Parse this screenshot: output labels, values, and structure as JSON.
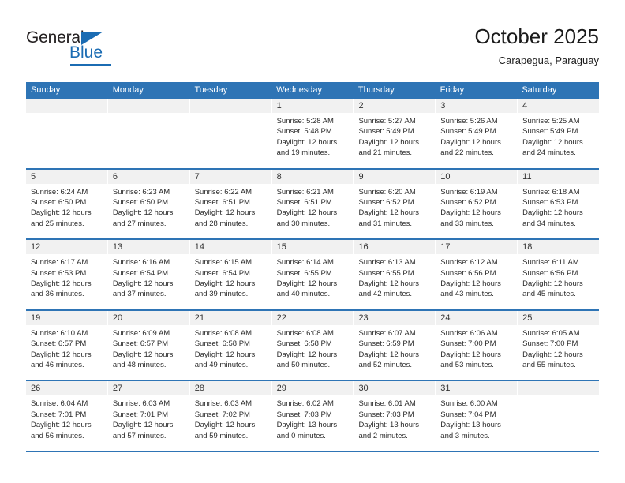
{
  "brand": {
    "name_part1": "General",
    "name_part2": "Blue",
    "accent_color": "#1b6cb3"
  },
  "header": {
    "title": "October 2025",
    "subtitle": "Carapegua, Paraguay"
  },
  "calendar": {
    "header_bg": "#2e74b5",
    "daynum_bg": "#f1f1f1",
    "weekdays": [
      "Sunday",
      "Monday",
      "Tuesday",
      "Wednesday",
      "Thursday",
      "Friday",
      "Saturday"
    ],
    "weeks": [
      [
        {
          "day": "",
          "lines": []
        },
        {
          "day": "",
          "lines": []
        },
        {
          "day": "",
          "lines": []
        },
        {
          "day": "1",
          "lines": [
            "Sunrise: 5:28 AM",
            "Sunset: 5:48 PM",
            "Daylight: 12 hours",
            "and 19 minutes."
          ]
        },
        {
          "day": "2",
          "lines": [
            "Sunrise: 5:27 AM",
            "Sunset: 5:49 PM",
            "Daylight: 12 hours",
            "and 21 minutes."
          ]
        },
        {
          "day": "3",
          "lines": [
            "Sunrise: 5:26 AM",
            "Sunset: 5:49 PM",
            "Daylight: 12 hours",
            "and 22 minutes."
          ]
        },
        {
          "day": "4",
          "lines": [
            "Sunrise: 5:25 AM",
            "Sunset: 5:49 PM",
            "Daylight: 12 hours",
            "and 24 minutes."
          ]
        }
      ],
      [
        {
          "day": "5",
          "lines": [
            "Sunrise: 6:24 AM",
            "Sunset: 6:50 PM",
            "Daylight: 12 hours",
            "and 25 minutes."
          ]
        },
        {
          "day": "6",
          "lines": [
            "Sunrise: 6:23 AM",
            "Sunset: 6:50 PM",
            "Daylight: 12 hours",
            "and 27 minutes."
          ]
        },
        {
          "day": "7",
          "lines": [
            "Sunrise: 6:22 AM",
            "Sunset: 6:51 PM",
            "Daylight: 12 hours",
            "and 28 minutes."
          ]
        },
        {
          "day": "8",
          "lines": [
            "Sunrise: 6:21 AM",
            "Sunset: 6:51 PM",
            "Daylight: 12 hours",
            "and 30 minutes."
          ]
        },
        {
          "day": "9",
          "lines": [
            "Sunrise: 6:20 AM",
            "Sunset: 6:52 PM",
            "Daylight: 12 hours",
            "and 31 minutes."
          ]
        },
        {
          "day": "10",
          "lines": [
            "Sunrise: 6:19 AM",
            "Sunset: 6:52 PM",
            "Daylight: 12 hours",
            "and 33 minutes."
          ]
        },
        {
          "day": "11",
          "lines": [
            "Sunrise: 6:18 AM",
            "Sunset: 6:53 PM",
            "Daylight: 12 hours",
            "and 34 minutes."
          ]
        }
      ],
      [
        {
          "day": "12",
          "lines": [
            "Sunrise: 6:17 AM",
            "Sunset: 6:53 PM",
            "Daylight: 12 hours",
            "and 36 minutes."
          ]
        },
        {
          "day": "13",
          "lines": [
            "Sunrise: 6:16 AM",
            "Sunset: 6:54 PM",
            "Daylight: 12 hours",
            "and 37 minutes."
          ]
        },
        {
          "day": "14",
          "lines": [
            "Sunrise: 6:15 AM",
            "Sunset: 6:54 PM",
            "Daylight: 12 hours",
            "and 39 minutes."
          ]
        },
        {
          "day": "15",
          "lines": [
            "Sunrise: 6:14 AM",
            "Sunset: 6:55 PM",
            "Daylight: 12 hours",
            "and 40 minutes."
          ]
        },
        {
          "day": "16",
          "lines": [
            "Sunrise: 6:13 AM",
            "Sunset: 6:55 PM",
            "Daylight: 12 hours",
            "and 42 minutes."
          ]
        },
        {
          "day": "17",
          "lines": [
            "Sunrise: 6:12 AM",
            "Sunset: 6:56 PM",
            "Daylight: 12 hours",
            "and 43 minutes."
          ]
        },
        {
          "day": "18",
          "lines": [
            "Sunrise: 6:11 AM",
            "Sunset: 6:56 PM",
            "Daylight: 12 hours",
            "and 45 minutes."
          ]
        }
      ],
      [
        {
          "day": "19",
          "lines": [
            "Sunrise: 6:10 AM",
            "Sunset: 6:57 PM",
            "Daylight: 12 hours",
            "and 46 minutes."
          ]
        },
        {
          "day": "20",
          "lines": [
            "Sunrise: 6:09 AM",
            "Sunset: 6:57 PM",
            "Daylight: 12 hours",
            "and 48 minutes."
          ]
        },
        {
          "day": "21",
          "lines": [
            "Sunrise: 6:08 AM",
            "Sunset: 6:58 PM",
            "Daylight: 12 hours",
            "and 49 minutes."
          ]
        },
        {
          "day": "22",
          "lines": [
            "Sunrise: 6:08 AM",
            "Sunset: 6:58 PM",
            "Daylight: 12 hours",
            "and 50 minutes."
          ]
        },
        {
          "day": "23",
          "lines": [
            "Sunrise: 6:07 AM",
            "Sunset: 6:59 PM",
            "Daylight: 12 hours",
            "and 52 minutes."
          ]
        },
        {
          "day": "24",
          "lines": [
            "Sunrise: 6:06 AM",
            "Sunset: 7:00 PM",
            "Daylight: 12 hours",
            "and 53 minutes."
          ]
        },
        {
          "day": "25",
          "lines": [
            "Sunrise: 6:05 AM",
            "Sunset: 7:00 PM",
            "Daylight: 12 hours",
            "and 55 minutes."
          ]
        }
      ],
      [
        {
          "day": "26",
          "lines": [
            "Sunrise: 6:04 AM",
            "Sunset: 7:01 PM",
            "Daylight: 12 hours",
            "and 56 minutes."
          ]
        },
        {
          "day": "27",
          "lines": [
            "Sunrise: 6:03 AM",
            "Sunset: 7:01 PM",
            "Daylight: 12 hours",
            "and 57 minutes."
          ]
        },
        {
          "day": "28",
          "lines": [
            "Sunrise: 6:03 AM",
            "Sunset: 7:02 PM",
            "Daylight: 12 hours",
            "and 59 minutes."
          ]
        },
        {
          "day": "29",
          "lines": [
            "Sunrise: 6:02 AM",
            "Sunset: 7:03 PM",
            "Daylight: 13 hours",
            "and 0 minutes."
          ]
        },
        {
          "day": "30",
          "lines": [
            "Sunrise: 6:01 AM",
            "Sunset: 7:03 PM",
            "Daylight: 13 hours",
            "and 2 minutes."
          ]
        },
        {
          "day": "31",
          "lines": [
            "Sunrise: 6:00 AM",
            "Sunset: 7:04 PM",
            "Daylight: 13 hours",
            "and 3 minutes."
          ]
        },
        {
          "day": "",
          "lines": []
        }
      ]
    ]
  }
}
